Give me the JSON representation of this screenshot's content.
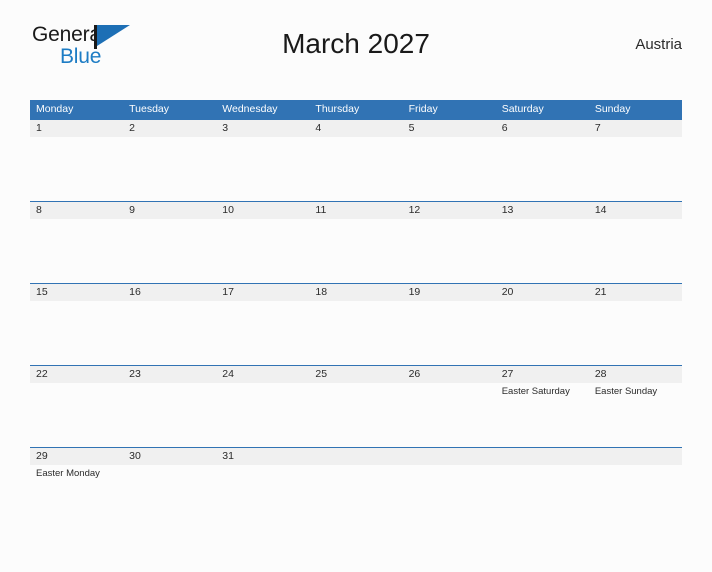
{
  "logo": {
    "line1": "General",
    "line2": "Blue",
    "flag_icon": "blue-flag-icon",
    "color_dark": "#1a1a1a",
    "color_blue": "#1d7cc4"
  },
  "header": {
    "title": "March 2027",
    "country": "Austria"
  },
  "theme": {
    "header_blue": "#3173b4",
    "band_gray": "#f0f0f0",
    "page_background": "#fcfcfc",
    "text_dark": "#2b2b2b"
  },
  "calendar": {
    "weekdays": [
      "Monday",
      "Tuesday",
      "Wednesday",
      "Thursday",
      "Friday",
      "Saturday",
      "Sunday"
    ],
    "weeks": [
      [
        {
          "date": "1",
          "event": ""
        },
        {
          "date": "2",
          "event": ""
        },
        {
          "date": "3",
          "event": ""
        },
        {
          "date": "4",
          "event": ""
        },
        {
          "date": "5",
          "event": ""
        },
        {
          "date": "6",
          "event": ""
        },
        {
          "date": "7",
          "event": ""
        }
      ],
      [
        {
          "date": "8",
          "event": ""
        },
        {
          "date": "9",
          "event": ""
        },
        {
          "date": "10",
          "event": ""
        },
        {
          "date": "11",
          "event": ""
        },
        {
          "date": "12",
          "event": ""
        },
        {
          "date": "13",
          "event": ""
        },
        {
          "date": "14",
          "event": ""
        }
      ],
      [
        {
          "date": "15",
          "event": ""
        },
        {
          "date": "16",
          "event": ""
        },
        {
          "date": "17",
          "event": ""
        },
        {
          "date": "18",
          "event": ""
        },
        {
          "date": "19",
          "event": ""
        },
        {
          "date": "20",
          "event": ""
        },
        {
          "date": "21",
          "event": ""
        }
      ],
      [
        {
          "date": "22",
          "event": ""
        },
        {
          "date": "23",
          "event": ""
        },
        {
          "date": "24",
          "event": ""
        },
        {
          "date": "25",
          "event": ""
        },
        {
          "date": "26",
          "event": ""
        },
        {
          "date": "27",
          "event": "Easter Saturday"
        },
        {
          "date": "28",
          "event": "Easter Sunday"
        }
      ],
      [
        {
          "date": "29",
          "event": "Easter Monday"
        },
        {
          "date": "30",
          "event": ""
        },
        {
          "date": "31",
          "event": ""
        },
        {
          "date": "",
          "event": ""
        },
        {
          "date": "",
          "event": ""
        },
        {
          "date": "",
          "event": ""
        },
        {
          "date": "",
          "event": ""
        }
      ]
    ]
  }
}
